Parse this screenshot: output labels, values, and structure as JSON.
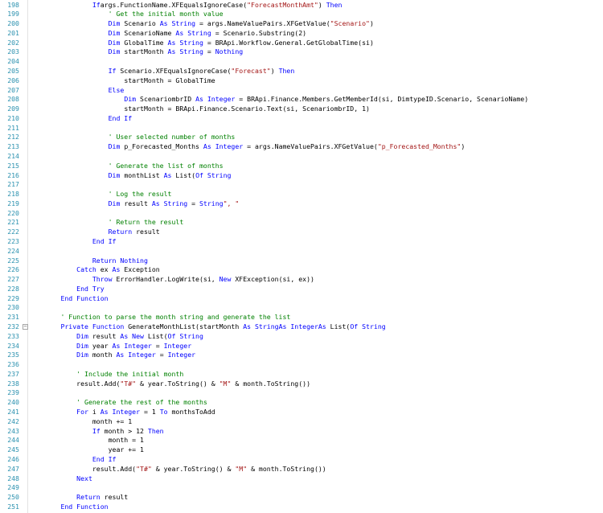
{
  "editor": {
    "first_line": 198,
    "indent_unit": "    ",
    "colors": {
      "keyword": "#0000ff",
      "string": "#a31515",
      "comment": "#008000",
      "type": "#2b91af",
      "line_number": "#2b91af",
      "text": "#000000"
    },
    "fold_markers": [
      232
    ],
    "lines": [
      {
        "n": "198",
        "indent": 4,
        "tokens": [
          [
            "kw",
            "If"
          ],
          [
            "",
            "args.FunctionName.XFEqualsIgnoreCase("
          ],
          [
            "str",
            "\"ForecastMonthAmt\""
          ],
          [
            "",
            ")"
          ],
          [
            "kw",
            " Then"
          ]
        ]
      },
      {
        "n": "199",
        "indent": 5,
        "tokens": [
          [
            "cm",
            "' Get the initial month value"
          ]
        ]
      },
      {
        "n": "200",
        "indent": 5,
        "tokens": [
          [
            "kw",
            "Dim"
          ],
          [
            "",
            " Scenario "
          ],
          [
            "kw",
            "As String"
          ],
          [
            "",
            " = args.NameValuePairs.XFGetValue("
          ],
          [
            "str",
            "\"Scenario\""
          ],
          [
            "",
            ")"
          ]
        ]
      },
      {
        "n": "201",
        "indent": 5,
        "tokens": [
          [
            "kw",
            "Dim"
          ],
          [
            "",
            " ScenarioName "
          ],
          [
            "kw",
            "As String"
          ],
          [
            "",
            " = Scenario.Substring(2)"
          ]
        ]
      },
      {
        "n": "202",
        "indent": 5,
        "tokens": [
          [
            "kw",
            "Dim"
          ],
          [
            "",
            " GlobalTime "
          ],
          [
            "kw",
            "As String"
          ],
          [
            "",
            " = BRApi.Workflow.General.GetGlobalTime(si)"
          ]
        ]
      },
      {
        "n": "203",
        "indent": 5,
        "tokens": [
          [
            "kw",
            "Dim"
          ],
          [
            "",
            " startMonth "
          ],
          [
            "kw",
            "As String"
          ],
          [
            "",
            " = "
          ],
          [
            "kw",
            "Nothing"
          ]
        ]
      },
      {
        "n": "204",
        "indent": 0,
        "tokens": []
      },
      {
        "n": "205",
        "indent": 5,
        "tokens": [
          [
            "kw",
            "If"
          ],
          [
            "",
            " Scenario.XFEqualsIgnoreCase("
          ],
          [
            "str",
            "\"Forecast\""
          ],
          [
            "",
            ")"
          ],
          [
            "kw",
            " Then"
          ]
        ]
      },
      {
        "n": "206",
        "indent": 6,
        "tokens": [
          [
            "",
            "startMonth = GlobalTime"
          ]
        ]
      },
      {
        "n": "207",
        "indent": 5,
        "tokens": [
          [
            "kw",
            "Else"
          ]
        ]
      },
      {
        "n": "208",
        "indent": 6,
        "tokens": [
          [
            "kw",
            "Dim"
          ],
          [
            "",
            " ScenariombrID "
          ],
          [
            "kw",
            "As Integer"
          ],
          [
            "",
            " = BRApi.Finance.Members.GetMemberId(si, DimtypeID.Scenario, ScenarioName)"
          ]
        ]
      },
      {
        "n": "209",
        "indent": 6,
        "tokens": [
          [
            "",
            "startMonth = BRApi.Finance.Scenario.Text(si, ScenariombrID, 1)"
          ]
        ]
      },
      {
        "n": "210",
        "indent": 5,
        "tokens": [
          [
            "kw",
            "End If"
          ]
        ]
      },
      {
        "n": "211",
        "indent": 0,
        "tokens": []
      },
      {
        "n": "212",
        "indent": 5,
        "tokens": [
          [
            "cm",
            "' User selected number of months"
          ]
        ]
      },
      {
        "n": "213",
        "indent": 5,
        "tokens": [
          [
            "kw",
            "Dim"
          ],
          [
            "",
            " p_Forecasted_Months "
          ],
          [
            "kw",
            "As Integer"
          ],
          [
            "",
            " = args.NameValuePairs.XFGetValue("
          ],
          [
            "str",
            "\"p_Forecasted_Months\""
          ],
          [
            "",
            ")"
          ]
        ]
      },
      {
        "n": "214",
        "indent": 0,
        "tokens": []
      },
      {
        "n": "215",
        "indent": 5,
        "tokens": [
          [
            "cm",
            "' Generate the list of months"
          ]
        ]
      },
      {
        "n": "216",
        "indent": 5,
        "tokens": [
          [
            "kw",
            "Dim"
          ],
          [
            "",
            " monthList "
          ],
          [
            "kw",
            "As"
          ],
          [
            "",
            " List("
          ],
          [
            "kw",
            "Of String"
          ],
          [
            ") = GenerateMonthList(startMonth, p_Forecasted_Months)"
          ]
        ]
      },
      {
        "n": "217",
        "indent": 0,
        "tokens": []
      },
      {
        "n": "218",
        "indent": 5,
        "tokens": [
          [
            "cm",
            "' Log the result"
          ]
        ]
      },
      {
        "n": "219",
        "indent": 5,
        "tokens": [
          [
            "kw",
            "Dim"
          ],
          [
            "",
            " result "
          ],
          [
            "kw",
            "As String"
          ],
          [
            "",
            " = "
          ],
          [
            "kw",
            "String"
          ],
          [
            ".Join("
          ],
          [
            "str",
            "\", \""
          ],
          [
            ", monthList)"
          ]
        ]
      },
      {
        "n": "220",
        "indent": 0,
        "tokens": []
      },
      {
        "n": "221",
        "indent": 5,
        "tokens": [
          [
            "cm",
            "' Return the result"
          ]
        ]
      },
      {
        "n": "222",
        "indent": 5,
        "tokens": [
          [
            "kw",
            "Return"
          ],
          [
            "",
            " result"
          ]
        ]
      },
      {
        "n": "223",
        "indent": 4,
        "tokens": [
          [
            "kw",
            "End If"
          ]
        ]
      },
      {
        "n": "224",
        "indent": 0,
        "tokens": []
      },
      {
        "n": "225",
        "indent": 4,
        "tokens": [
          [
            "kw",
            "Return Nothing"
          ]
        ]
      },
      {
        "n": "226",
        "indent": 3,
        "tokens": [
          [
            "kw",
            "Catch"
          ],
          [
            "",
            " ex "
          ],
          [
            "kw",
            "As"
          ],
          [
            "",
            " Exception"
          ]
        ]
      },
      {
        "n": "227",
        "indent": 4,
        "tokens": [
          [
            "kw",
            "Throw"
          ],
          [
            "",
            " ErrorHandler.LogWrite(si, "
          ],
          [
            "kw",
            "New"
          ],
          [
            "",
            " XFException(si, ex))"
          ]
        ]
      },
      {
        "n": "228",
        "indent": 3,
        "tokens": [
          [
            "kw",
            "End Try"
          ]
        ]
      },
      {
        "n": "229",
        "indent": 2,
        "tokens": [
          [
            "kw",
            "End Function"
          ]
        ]
      },
      {
        "n": "230",
        "indent": 0,
        "tokens": []
      },
      {
        "n": "231",
        "indent": 2,
        "tokens": [
          [
            "cm",
            "' Function to parse the month string and generate the list"
          ]
        ]
      },
      {
        "n": "232",
        "indent": 2,
        "tokens": [
          [
            "kw",
            "Private Function"
          ],
          [
            "",
            " GenerateMonthList(startMonth "
          ],
          [
            "kw",
            "As String"
          ],
          [
            ", monthsToAdd "
          ],
          [
            "kw",
            "As Integer"
          ],
          [
            ") "
          ],
          [
            "kw",
            "As"
          ],
          [
            "",
            " List("
          ],
          [
            "kw",
            "Of String"
          ],
          [
            ")"
          ]
        ]
      },
      {
        "n": "233",
        "indent": 3,
        "tokens": [
          [
            "kw",
            "Dim"
          ],
          [
            "",
            " result "
          ],
          [
            "kw",
            "As New"
          ],
          [
            "",
            " List("
          ],
          [
            "kw",
            "Of String"
          ],
          [
            ")"
          ]
        ]
      },
      {
        "n": "234",
        "indent": 3,
        "tokens": [
          [
            "kw",
            "Dim"
          ],
          [
            "",
            " year "
          ],
          [
            "kw",
            "As Integer"
          ],
          [
            "",
            " = "
          ],
          [
            "kw",
            "Integer"
          ],
          [
            ".Parse(startMonth.Substring(0, 4))"
          ]
        ]
      },
      {
        "n": "235",
        "indent": 3,
        "tokens": [
          [
            "kw",
            "Dim"
          ],
          [
            "",
            " month "
          ],
          [
            "kw",
            "As Integer"
          ],
          [
            "",
            " = "
          ],
          [
            "kw",
            "Integer"
          ],
          [
            ".Parse(startMonth.Substring(5))"
          ]
        ]
      },
      {
        "n": "236",
        "indent": 0,
        "tokens": []
      },
      {
        "n": "237",
        "indent": 3,
        "tokens": [
          [
            "cm",
            "' Include the initial month"
          ]
        ]
      },
      {
        "n": "238",
        "indent": 3,
        "tokens": [
          [
            "",
            "result.Add("
          ],
          [
            "str",
            "\"T#\""
          ],
          [
            "",
            " & year.ToString() & "
          ],
          [
            "str",
            "\"M\""
          ],
          [
            "",
            " & month.ToString())"
          ]
        ]
      },
      {
        "n": "239",
        "indent": 0,
        "tokens": []
      },
      {
        "n": "240",
        "indent": 3,
        "tokens": [
          [
            "cm",
            "' Generate the rest of the months"
          ]
        ]
      },
      {
        "n": "241",
        "indent": 3,
        "tokens": [
          [
            "kw",
            "For"
          ],
          [
            "",
            " i "
          ],
          [
            "kw",
            "As Integer"
          ],
          [
            "",
            " = 1 "
          ],
          [
            "kw",
            "To"
          ],
          [
            "",
            " monthsToAdd"
          ]
        ]
      },
      {
        "n": "242",
        "indent": 4,
        "tokens": [
          [
            "",
            "month += 1"
          ]
        ]
      },
      {
        "n": "243",
        "indent": 4,
        "tokens": [
          [
            "kw",
            "If"
          ],
          [
            "",
            " month > 12 "
          ],
          [
            "kw",
            "Then"
          ]
        ]
      },
      {
        "n": "244",
        "indent": 5,
        "tokens": [
          [
            "",
            "month = 1"
          ]
        ]
      },
      {
        "n": "245",
        "indent": 5,
        "tokens": [
          [
            "",
            "year += 1"
          ]
        ]
      },
      {
        "n": "246",
        "indent": 4,
        "tokens": [
          [
            "kw",
            "End If"
          ]
        ]
      },
      {
        "n": "247",
        "indent": 4,
        "tokens": [
          [
            "",
            "result.Add("
          ],
          [
            "str",
            "\"T#\""
          ],
          [
            "",
            " & year.ToString() & "
          ],
          [
            "str",
            "\"M\""
          ],
          [
            "",
            " & month.ToString())"
          ]
        ]
      },
      {
        "n": "248",
        "indent": 3,
        "tokens": [
          [
            "kw",
            "Next"
          ]
        ]
      },
      {
        "n": "249",
        "indent": 0,
        "tokens": []
      },
      {
        "n": "250",
        "indent": 3,
        "tokens": [
          [
            "kw",
            "Return"
          ],
          [
            "",
            " result"
          ]
        ]
      },
      {
        "n": "251",
        "indent": 2,
        "tokens": [
          [
            "kw",
            "End Function"
          ]
        ]
      }
    ]
  }
}
